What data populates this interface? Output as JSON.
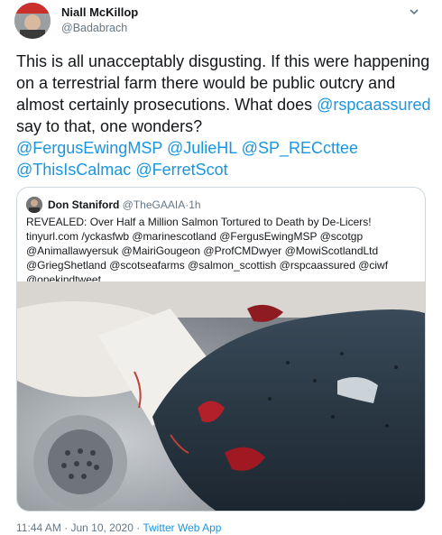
{
  "author": {
    "name": "Niall McKillop",
    "handle": "@Badabrach"
  },
  "tweet": {
    "text_parts": [
      "This is all unacceptably disgusting. If this were happening on a terrestrial farm there would be public outcry and almost certainly prosecutions. What does ",
      "@rspcaassured",
      " say to that, one wonders?",
      "@FergusEwingMSP",
      "@JulieHL",
      "@SP_RECcttee",
      "@ThisIsCalmac",
      "@FerretScot"
    ]
  },
  "quoted": {
    "name": "Don Staniford",
    "handle": "@TheGAAIA",
    "separator": "·",
    "time": "1h",
    "text": "REVEALED: Over Half a Million Salmon Tortured to Death by De-Licers! tinyurl.com /yckasfwb @marinescotland @FergusEwingMSP @scotgp @Animallawyersuk @MairiGougeon @ProfCMDwyer @MowiScotlandLtd @GriegShetland @scotseafarms @salmon_scottish @rspcaassured @ciwf @onekindtweet"
  },
  "footer": {
    "time": "11:44 AM · Jun 10, 2020 ·",
    "app": "Twitter Web App"
  },
  "colors": {
    "link": "#1b95e0",
    "secondary_text": "#657786",
    "border": "#ccd6dd"
  },
  "icons": {
    "menu": "chevron-down-icon"
  }
}
